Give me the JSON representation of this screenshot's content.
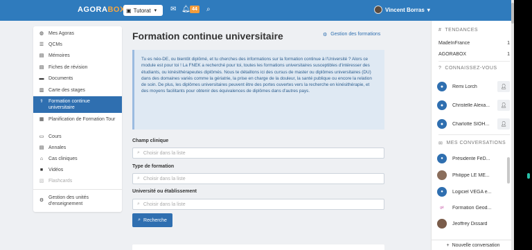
{
  "topbar": {
    "logo_main": "AGORA",
    "logo_accent": "BOX",
    "tutorat_label": "Tutorat",
    "notification_count": "44",
    "user_name": "Vincent Borras"
  },
  "sidebar": {
    "items": [
      {
        "label": "Mes Agoras",
        "icon": "globe-icon"
      },
      {
        "label": "QCMs",
        "icon": "list-icon"
      },
      {
        "label": "Mémoires",
        "icon": "file-icon"
      },
      {
        "label": "Fiches de révision",
        "icon": "file-icon"
      },
      {
        "label": "Documents",
        "icon": "folder-icon"
      },
      {
        "label": "Carte des stages",
        "icon": "map-icon"
      },
      {
        "label": "Formation continue universitaire",
        "icon": "stethoscope-icon"
      },
      {
        "label": "Planification de Formation Tour",
        "icon": "calendar-icon"
      },
      {
        "label": "Cours",
        "icon": "book-icon"
      },
      {
        "label": "Annales",
        "icon": "file-icon"
      },
      {
        "label": "Cas cliniques",
        "icon": "bed-icon"
      },
      {
        "label": "Vidéos",
        "icon": "video-icon"
      },
      {
        "label": "Flashcards",
        "icon": "cards-icon"
      },
      {
        "label": "Gestion des unités d'enseignement",
        "icon": "gear-icon"
      }
    ]
  },
  "main": {
    "title": "Formation continue universitaire",
    "gestion_label": "Gestion des formations",
    "info_text": "Tu es néo-DE, ou bientôt diplômé, et tu cherches des informations sur la formation continue à l'Université ? Alors ce module est pour toi ! La FNEK a recherché pour toi, toutes les formations universitaires susceptibles d'intéresser des étudiants, ou kinésithérapeutes diplômés. Nous te détaillons ici des cursus de master ou diplômes universitaires (DU) dans des domaines variés comme la gériatrie, la prise en charge de la douleur, la santé publique ou encore la relation de soin. De plus, les diplômes universitaires peuvent être des portes ouvertes vers la recherche en kinésithérapie, et des moyens facilitants pour obtenir des équivalences de diplômes dans d'autres pays.",
    "fields": [
      {
        "label": "Champ clinique",
        "placeholder": "Choisir dans la liste"
      },
      {
        "label": "Type de formation",
        "placeholder": "Choisir dans la liste"
      },
      {
        "label": "Université ou établissement",
        "placeholder": "Choisir dans la liste"
      }
    ],
    "search_label": "Recherche"
  },
  "right": {
    "trends_title": "TENDANCES",
    "trends": [
      {
        "name": "MadeInFrance",
        "count": "1"
      },
      {
        "name": "AGORABOX",
        "count": "1"
      }
    ],
    "people_title": "CONNAISSEZ-VOUS",
    "people": [
      "Remi Lorch",
      "Christelle Alexa...",
      "Charlotte SIOH..."
    ],
    "conv_title": "MES CONVERSATIONS",
    "conversations": [
      "Présidente FéD...",
      "Philippe LE ME...",
      "Logiciel VEGA e...",
      "Formation Geod...",
      "Jeoffrey Dissard"
    ],
    "new_conv_label": "Nouvelle conversation"
  }
}
